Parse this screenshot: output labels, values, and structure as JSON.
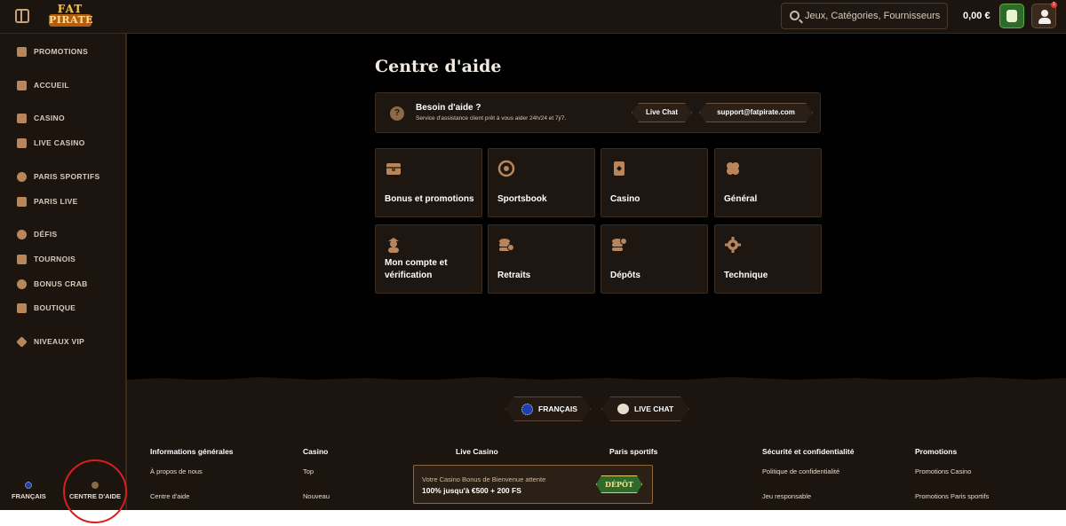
{
  "header": {
    "logo_top": "FAT",
    "logo_bottom": "PIRATE",
    "search_placeholder": "Jeux, Catégories, Fournisseurs",
    "balance": "0,00 €",
    "notification_count": "1"
  },
  "sidebar": {
    "items": [
      {
        "label": "PROMOTIONS",
        "icon": "gift-icon"
      },
      {
        "label": "ACCUEIL",
        "icon": "home-icon"
      },
      {
        "label": "CASINO",
        "icon": "casino-icon"
      },
      {
        "label": "LIVE CASINO",
        "icon": "live-casino-icon"
      },
      {
        "label": "PARIS SPORTIFS",
        "icon": "football-icon"
      },
      {
        "label": "PARIS LIVE",
        "icon": "live-icon"
      },
      {
        "label": "DÉFIS",
        "icon": "medal-icon"
      },
      {
        "label": "TOURNOIS",
        "icon": "trophy-icon"
      },
      {
        "label": "BONUS CRAB",
        "icon": "crab-icon"
      },
      {
        "label": "BOUTIQUE",
        "icon": "shop-icon"
      },
      {
        "label": "NIVEAUX VIP",
        "icon": "diamond-icon"
      }
    ],
    "bottom": {
      "language": "FRANÇAIS",
      "help": "CENTRE D'AIDE"
    }
  },
  "main": {
    "title": "Centre d'aide",
    "help_banner": {
      "title": "Besoin d'aide ?",
      "subtitle": "Service d'assistance client prêt à vous aider 24h/24 et 7j/7.",
      "live_chat": "Live Chat",
      "email": "support@fatpirate.com"
    },
    "categories": [
      {
        "label": "Bonus et promotions",
        "icon": "chest-icon"
      },
      {
        "label": "Sportsbook",
        "icon": "ball-icon"
      },
      {
        "label": "Casino",
        "icon": "cards-icon"
      },
      {
        "label": "Général",
        "icon": "clover-icon"
      },
      {
        "label": "Mon compte et vérification",
        "icon": "pirate-icon"
      },
      {
        "label": "Retraits",
        "icon": "coins-out-icon"
      },
      {
        "label": "Dépôts",
        "icon": "coins-in-icon"
      },
      {
        "label": "Technique",
        "icon": "gear-icon"
      }
    ]
  },
  "footer": {
    "language_button": "FRANÇAIS",
    "live_chat_button": "LIVE CHAT",
    "columns": [
      {
        "title": "Informations générales",
        "links": [
          "À propos de nous",
          "Centre d'aide"
        ]
      },
      {
        "title": "Casino",
        "links": [
          "Top",
          "Nouveau"
        ]
      },
      {
        "title": "Live Casino",
        "links": []
      },
      {
        "title": "Paris sportifs",
        "links": []
      },
      {
        "title": "Sécurité et confidentialité",
        "links": [
          "Politique de confidentialité",
          "Jeu responsable"
        ]
      },
      {
        "title": "Promotions",
        "links": [
          "Promotions Casino",
          "Promotions Paris sportifs"
        ]
      }
    ],
    "promo": {
      "line1": "Votre Casino Bonus de Bienvenue attente",
      "line2": "100% jusqu'à €500 + 200 FS",
      "button": "DÉPÔT"
    }
  },
  "colors": {
    "background": "#000000",
    "panel": "#1b140f",
    "card": "#1e1711",
    "accent_gold": "#b8865a",
    "highlight_circle": "#d81f1f"
  }
}
